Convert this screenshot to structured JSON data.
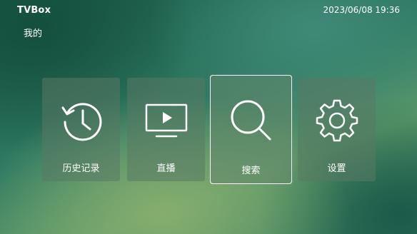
{
  "header": {
    "app_title": "TVBox",
    "clock": "2023/06/08 19:36"
  },
  "section": {
    "title": "我的"
  },
  "tiles": [
    {
      "label": "历史记录",
      "icon": "history-icon"
    },
    {
      "label": "直播",
      "icon": "tv-play-icon"
    },
    {
      "label": "搜索",
      "icon": "search-icon",
      "focused": true
    },
    {
      "label": "设置",
      "icon": "gear-icon"
    }
  ],
  "colors": {
    "text": "#ffffff",
    "focus_border": "#ffffff"
  }
}
